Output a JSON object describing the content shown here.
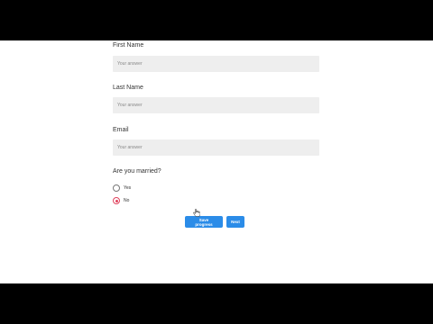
{
  "form": {
    "first_name": {
      "label": "First Name",
      "placeholder": "Your answer"
    },
    "last_name": {
      "label": "Last Name",
      "placeholder": "Your answer"
    },
    "email": {
      "label": "Email",
      "placeholder": "Your answer"
    },
    "married": {
      "question": "Are you married?",
      "options": [
        {
          "label": "Yes",
          "selected": false
        },
        {
          "label": "No",
          "selected": true
        }
      ]
    }
  },
  "buttons": {
    "save_progress": "Save progress",
    "next": "Next"
  },
  "colors": {
    "accent": "#2b8ce8",
    "radio_selected": "#e0445e",
    "input_background": "#eeeeee"
  },
  "icons": {
    "pointer": "hand-pointer-icon"
  }
}
